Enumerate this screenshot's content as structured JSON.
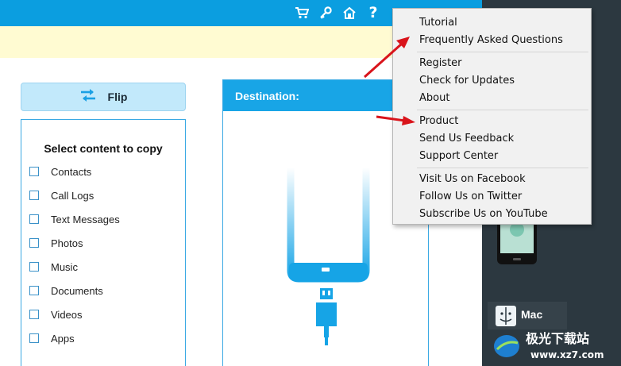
{
  "toolbar": {
    "icons": [
      "cart-icon",
      "key-icon",
      "home-icon",
      "help-icon"
    ],
    "help_glyph": "?"
  },
  "flip": {
    "label": "Flip"
  },
  "content": {
    "title": "Select content to copy",
    "items": [
      "Contacts",
      "Call Logs",
      "Text Messages",
      "Photos",
      "Music",
      "Documents",
      "Videos",
      "Apps"
    ]
  },
  "destination": {
    "title": "Destination:"
  },
  "sidebar": {
    "mac_label": "Mac"
  },
  "watermark": {
    "text_cn": "极光下载站",
    "url": "www.xz7.com"
  },
  "menu": {
    "items": [
      "Tutorial",
      "Frequently Asked Questions",
      "Register",
      "Check for Updates",
      "About",
      "Product",
      "Send Us Feedback",
      "Support Center",
      "Visit Us on Facebook",
      "Follow Us on Twitter",
      "Subscribe Us on YouTube"
    ]
  },
  "colors": {
    "topbar": "#0b9ee0",
    "accent": "#18a5e6",
    "notice": "#fffbd2",
    "dark_panel": "#2c3840",
    "annotation_arrow": "#d9141b"
  }
}
